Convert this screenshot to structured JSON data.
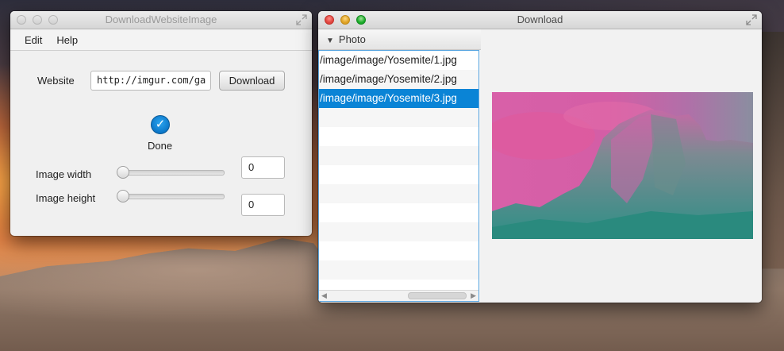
{
  "window1": {
    "title": "DownloadWebsiteImage",
    "menu": [
      "Edit",
      "Help"
    ],
    "website_label": "Website",
    "website_value": "http://imgur.com/ga",
    "download_button": "Download",
    "status_text": "Done",
    "width_label": "Image width",
    "height_label": "Image height",
    "width_value": "0",
    "height_value": "0"
  },
  "window2": {
    "title": "Download",
    "list_header": "Photo",
    "items": [
      "/image/image/Yosemite/1.jpg",
      "/image/image/Yosemite/2.jpg",
      "/image/image/Yosemite/3.jpg"
    ],
    "selected_index": 2
  },
  "colors": {
    "accent": "#0a84d6",
    "selection_border": "#5aa6e0"
  },
  "icons": {
    "check": "check-circle-icon",
    "disclosure": "triangle-down-icon",
    "fullscreen": "fullscreen-arrows-icon"
  }
}
